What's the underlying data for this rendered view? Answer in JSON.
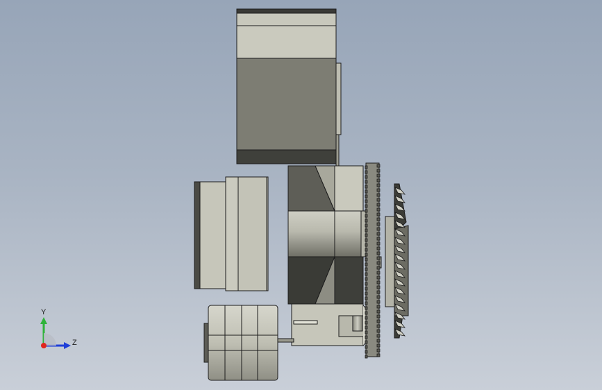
{
  "viewport": {
    "background_top": "#97a5b8",
    "background_bottom": "#c9cfd8"
  },
  "colors": {
    "body_light": "#c8c8bc",
    "body_mid": "#a6a69a",
    "body_dark": "#7f7f75",
    "body_shadow": "#3c3d38",
    "edge": "#1c1c1c",
    "axis_x": "#e0261e",
    "axis_y": "#2fb33a",
    "axis_z": "#1f3fd8"
  },
  "triad": {
    "y_label": "Y",
    "z_label": "Z"
  }
}
